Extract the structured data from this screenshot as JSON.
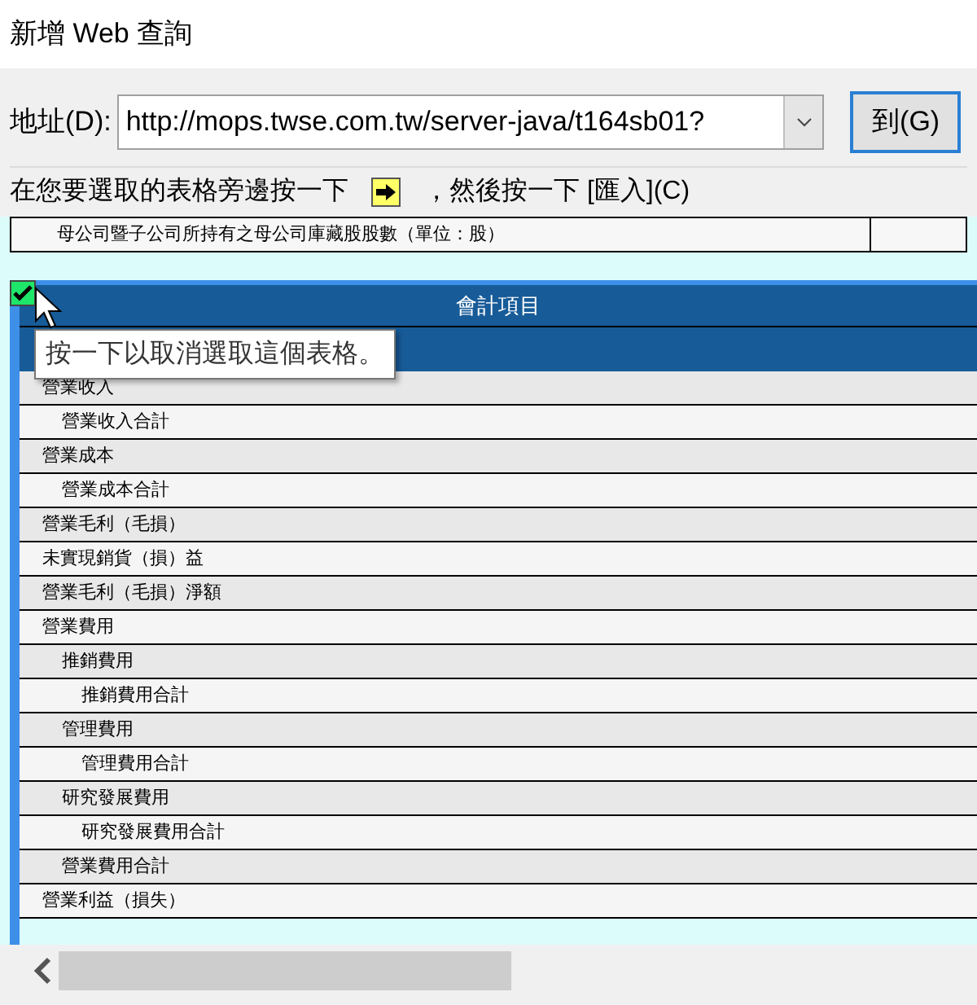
{
  "window": {
    "title": "新增 Web 查詢"
  },
  "address": {
    "label": "地址(D):",
    "value": "http://mops.twse.com.tw/server-java/t164sb01?",
    "go_button": "到(G)"
  },
  "instruction": {
    "before": "在您要選取的表格旁邊按一下",
    "after": "，然後按一下 [匯入](C)"
  },
  "top_table": {
    "cell": "母公司暨子公司所持有之母公司庫藏股股數（單位：股）"
  },
  "table": {
    "checked": true,
    "header": "會計項目",
    "tooltip": "按一下以取消選取這個表格。",
    "rows": [
      {
        "label": "營業收入",
        "children": [
          {
            "label": "營業收入合計"
          }
        ]
      },
      {
        "label": "營業成本",
        "children": [
          {
            "label": "營業成本合計"
          }
        ]
      },
      {
        "label": "營業毛利（毛損）"
      },
      {
        "label": "未實現銷貨（損）益"
      },
      {
        "label": "營業毛利（毛損）淨額"
      },
      {
        "label": "營業費用",
        "children": [
          {
            "label": "推銷費用",
            "children": [
              {
                "label": "推銷費用合計"
              }
            ]
          },
          {
            "label": "管理費用",
            "children": [
              {
                "label": "管理費用合計"
              }
            ]
          },
          {
            "label": "研究發展費用",
            "children": [
              {
                "label": "研究發展費用合計"
              }
            ]
          },
          {
            "label": "營業費用合計"
          }
        ]
      },
      {
        "label": "營業利益（損失）"
      }
    ]
  }
}
